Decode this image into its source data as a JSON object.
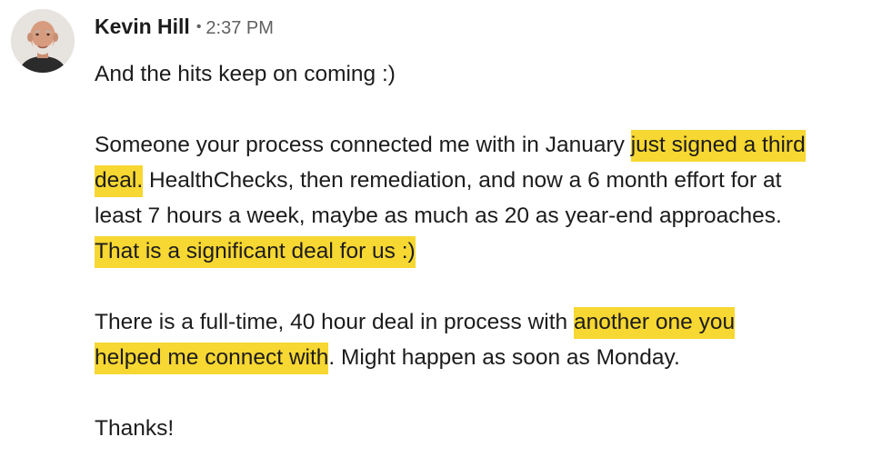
{
  "message": {
    "sender": "Kevin Hill",
    "separator": "•",
    "time": "2:37 PM",
    "avatar_icon": "person-avatar-photo",
    "highlight_color": "#f7d731",
    "lines": {
      "l1": "And the hits keep on coming :)",
      "l2a": "Someone your process connected me with in January ",
      "l2b": "just signed a third",
      "l3a": "deal.",
      "l3b": "  HealthChecks, then remediation, and now a 6 month effort for at",
      "l4": "least 7 hours a week, maybe as much as 20 as year-end approaches.",
      "l5": "That is a significant deal for us :)",
      "l6a": "There is a full-time, 40 hour deal in process with ",
      "l6b": "another one you",
      "l7a": "helped me connect with",
      "l7b": ".  Might happen as soon as Monday.",
      "l8": "Thanks!"
    }
  }
}
